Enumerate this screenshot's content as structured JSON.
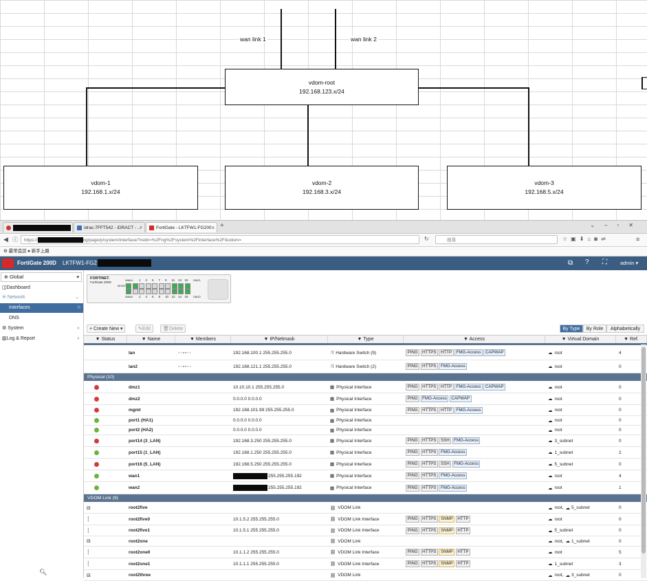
{
  "diagram": {
    "links": [
      "wan link 1",
      "wan link 2"
    ],
    "root": {
      "name": "vdom-root",
      "ip": "192.168.123.x/24"
    },
    "children": [
      {
        "name": "vdom-1",
        "ip": "192.168.1.x/24"
      },
      {
        "name": "vdom-2",
        "ip": "192.168.3.x/24"
      },
      {
        "name": "vdom-3",
        "ip": "192.168.5.x/24"
      }
    ]
  },
  "browser": {
    "tabs": [
      {
        "label": ""
      },
      {
        "label": "idrac-7FFT542 - iDRACT - ...",
        "close": "×"
      },
      {
        "label": "FortiGate - LKTFW1-FG200...",
        "close": "×"
      }
    ],
    "new_tab": "+",
    "url_prefix": "https://",
    "url_suffix": "ng/page/p/system/interface/?redir=%2Fng%2Fsystem%2Finterface%2F&vdom=",
    "search_placeholder": "搜尋",
    "bookmarks": [
      "最常造訪",
      "新手上路"
    ]
  },
  "fortigate": {
    "model": "FortiGate 200D",
    "hostname_prefix": "LKTFW1-FG2",
    "user": "admin",
    "vdom_select": "Global",
    "sidebar": {
      "dashboard": "Dashboard",
      "network": "Network",
      "interfaces": "Interfaces",
      "dns": "DNS",
      "system": "System",
      "log_report": "Log & Report"
    },
    "device": {
      "brand": "FORTINET.",
      "model": "FortiGate 200D",
      "mgmt": "MGMT",
      "wan1": "WAN1",
      "wan2": "WAN2",
      "dmz1": "DMZ1",
      "dmz2": "DMZ2",
      "top_ports": [
        "1",
        "3",
        "5",
        "7",
        "9",
        "11",
        "13",
        "15"
      ],
      "bottom_ports": [
        "2",
        "4",
        "6",
        "8",
        "10",
        "12",
        "14",
        "16"
      ]
    },
    "toolbar": {
      "create_new": "Create New",
      "edit": "Edit",
      "delete": "Delete"
    },
    "view_tabs": [
      "By Type",
      "By Role",
      "Alphabetically"
    ],
    "columns": [
      "Status",
      "Name",
      "Members",
      "IP/Netmask",
      "Type",
      "Access",
      "Virtual Domain",
      "Ref."
    ],
    "rows_top": [
      {
        "name": "lan",
        "ip": "192.168.100.1 255.255.255.0",
        "type": "Hardware Switch (9)",
        "access": [
          "PING",
          "HTTPS",
          "HTTP",
          "FMG-Access",
          "CAPWAP"
        ],
        "vdom": "root",
        "ref": "4"
      },
      {
        "name": "lan2",
        "ip": "192.168.121.1 255.255.255.0",
        "type": "Hardware Switch (2)",
        "access": [
          "PING",
          "HTTPS",
          "FMG-Access"
        ],
        "vdom": "root",
        "ref": "0"
      }
    ],
    "physical_group": "Physical (10)",
    "physical": [
      {
        "status": "down",
        "name": "dmz1",
        "ip": "10.10.10.1 255.255.255.0",
        "type": "Physical Interface",
        "access": [
          "PING",
          "HTTPS",
          "HTTP",
          "FMG-Access",
          "CAPWAP"
        ],
        "vdom": "root",
        "ref": "0"
      },
      {
        "status": "down",
        "name": "dmz2",
        "ip": "0.0.0.0 0.0.0.0",
        "type": "Physical Interface",
        "access": [
          "PING",
          "FMG-Access",
          "CAPWAP"
        ],
        "vdom": "root",
        "ref": "0"
      },
      {
        "status": "down",
        "name": "mgmt",
        "ip": "192.168.101.99 255.255.255.0",
        "type": "Physical Interface",
        "access": [
          "PING",
          "HTTPS",
          "HTTP",
          "FMG-Access"
        ],
        "vdom": "root",
        "ref": "0"
      },
      {
        "status": "up",
        "name": "port1 (HA1)",
        "ip": "0.0.0.0 0.0.0.0",
        "type": "Physical Interface",
        "access": [],
        "vdom": "root",
        "ref": "0"
      },
      {
        "status": "up",
        "name": "port2 (HA2)",
        "ip": "0.0.0.0 0.0.0.0",
        "type": "Physical Interface",
        "access": [],
        "vdom": "root",
        "ref": "0"
      },
      {
        "status": "down",
        "name": "port14 (3_LAN)",
        "ip": "192.168.3.250 255.255.255.0",
        "type": "Physical Interface",
        "access": [
          "PING",
          "HTTPS",
          "SSH",
          "FMG-Access"
        ],
        "vdom": "3_subnet",
        "ref": "0"
      },
      {
        "status": "up",
        "name": "port15 (1_LAN)",
        "ip": "192.168.1.250 255.255.255.0",
        "type": "Physical Interface",
        "access": [
          "PING",
          "HTTPS",
          "FMG-Access"
        ],
        "vdom": "1_subnet",
        "ref": "2"
      },
      {
        "status": "down",
        "name": "port16 (5_LAN)",
        "ip": "192.168.5.250 255.255.255.0",
        "type": "Physical Interface",
        "access": [
          "PING",
          "HTTPS",
          "SSH",
          "FMG-Access"
        ],
        "vdom": "5_subnet",
        "ref": "0"
      },
      {
        "status": "up",
        "name": "wan1",
        "ip": "255.255.255.192",
        "type": "Physical Interface",
        "access": [
          "PING",
          "HTTPS",
          "FMG-Access"
        ],
        "vdom": "root",
        "ref": "4"
      },
      {
        "status": "up",
        "name": "wan2",
        "ip": "255.255.255.192",
        "type": "Physical Interface",
        "access": [
          "PING",
          "HTTPS",
          "FMG-Access"
        ],
        "vdom": "root",
        "ref": "1"
      }
    ],
    "vdomlink_group": "VDOM Link (9)",
    "vdomlinks": [
      {
        "name": "root2five",
        "ip": "",
        "type": "VDOM Link",
        "access": [],
        "vdom": "root,",
        "vdom2": "5_subnet",
        "ref": "0",
        "parent": true
      },
      {
        "name": "root2five0",
        "ip": "10.1.5.2 255.255.255.0",
        "type": "VDOM Link Interface",
        "access": [
          "PING",
          "HTTPS",
          "SNMP",
          "HTTP"
        ],
        "vdom": "root",
        "vdom2": "",
        "ref": "0",
        "parent": false
      },
      {
        "name": "root2five1",
        "ip": "10.1.5.1 255.255.255.0",
        "type": "VDOM Link Interface",
        "access": [
          "PING",
          "HTTPS",
          "SNMP",
          "HTTP"
        ],
        "vdom": "5_subnet",
        "vdom2": "",
        "ref": "0",
        "parent": false
      },
      {
        "name": "root2one",
        "ip": "",
        "type": "VDOM Link",
        "access": [],
        "vdom": "root,",
        "vdom2": "1_subnet",
        "ref": "0",
        "parent": true
      },
      {
        "name": "root2one0",
        "ip": "10.1.1.2 255.255.255.0",
        "type": "VDOM Link Interface",
        "access": [
          "PING",
          "HTTPS",
          "SNMP",
          "HTTP"
        ],
        "vdom": "root",
        "vdom2": "",
        "ref": "5",
        "parent": false
      },
      {
        "name": "root2one1",
        "ip": "10.1.1.1 255.255.255.0",
        "type": "VDOM Link Interface",
        "access": [
          "PING",
          "HTTPS",
          "SNMP",
          "HTTP"
        ],
        "vdom": "1_subnet",
        "vdom2": "",
        "ref": "3",
        "parent": false
      },
      {
        "name": "root2three",
        "ip": "",
        "type": "VDOM Link",
        "access": [],
        "vdom": "root,",
        "vdom2": "3_subnet",
        "ref": "0",
        "parent": true
      }
    ],
    "colors": {
      "header": "#3c5d82",
      "selected": "#3f6da0",
      "up": "#6cb33e",
      "down": "#d13b3b"
    }
  }
}
